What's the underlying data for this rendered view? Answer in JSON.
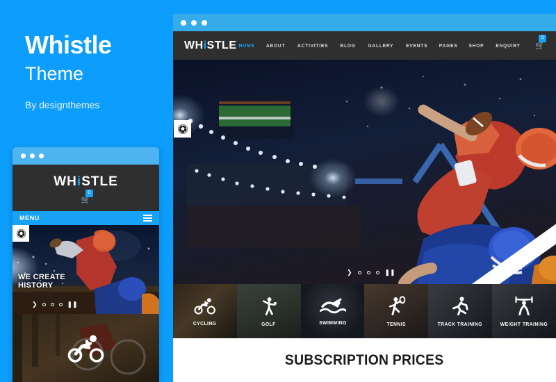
{
  "promo": {
    "title": "Whistle",
    "subtitle": "Theme",
    "author": "By designthemes"
  },
  "colors": {
    "background_blue": "#0d9dfc",
    "accent_blue": "#17a2f5",
    "titlebar_blue": "#35ace9",
    "mobile_titlebar_blue": "#4db4ef",
    "dark_header": "#2f2f2f"
  },
  "mobile_window": {
    "titlebar_dots": 3,
    "logo": {
      "prefix": "WH",
      "accent": "i",
      "suffix": "STLE"
    },
    "cart": {
      "icon": "cart-icon",
      "badge": "0"
    },
    "menu_bar": {
      "label": "MENU",
      "icon": "hamburger-icon"
    },
    "hero": {
      "slogan_line1": "WE CREATE",
      "slogan_line2": "HISTORY",
      "badge_icon": "soccer-ball-icon",
      "controls": {
        "next_icon": "chevron-right-icon",
        "dots": 3,
        "pause_icon": "pause-icon"
      }
    },
    "category_tile": {
      "icon": "cycling-icon",
      "name": "cycling"
    }
  },
  "desktop_window": {
    "titlebar_dots": 3,
    "logo": {
      "prefix": "WH",
      "accent": "i",
      "suffix": "STLE"
    },
    "nav": [
      {
        "label": "HOME",
        "active": true
      },
      {
        "label": "ABOUT",
        "active": false
      },
      {
        "label": "ACTIVITIES",
        "active": false
      },
      {
        "label": "BLOG",
        "active": false
      },
      {
        "label": "GALLERY",
        "active": false
      },
      {
        "label": "EVENTS",
        "active": false
      },
      {
        "label": "PAGES",
        "active": false
      },
      {
        "label": "SHOP",
        "active": false
      },
      {
        "label": "ENQUIRY",
        "active": false
      }
    ],
    "cart": {
      "icon": "cart-icon",
      "badge": "0"
    },
    "hero": {
      "badge_icon": "soccer-ball-icon",
      "controls": {
        "next_icon": "chevron-right-icon",
        "dots": 3,
        "pause_icon": "pause-icon"
      }
    },
    "categories": [
      {
        "label": "CYCLING",
        "icon": "cycling-icon"
      },
      {
        "label": "GOLF",
        "icon": "golf-icon"
      },
      {
        "label": "SWIMMING",
        "icon": "swimming-icon"
      },
      {
        "label": "TENNIS",
        "icon": "tennis-icon"
      },
      {
        "label": "TRACK TRAINING",
        "icon": "running-icon"
      },
      {
        "label": "WEIGHT TRAINING",
        "icon": "weightlifting-icon"
      }
    ],
    "subscription": {
      "title": "SUBSCRIPTION PRICES"
    }
  }
}
